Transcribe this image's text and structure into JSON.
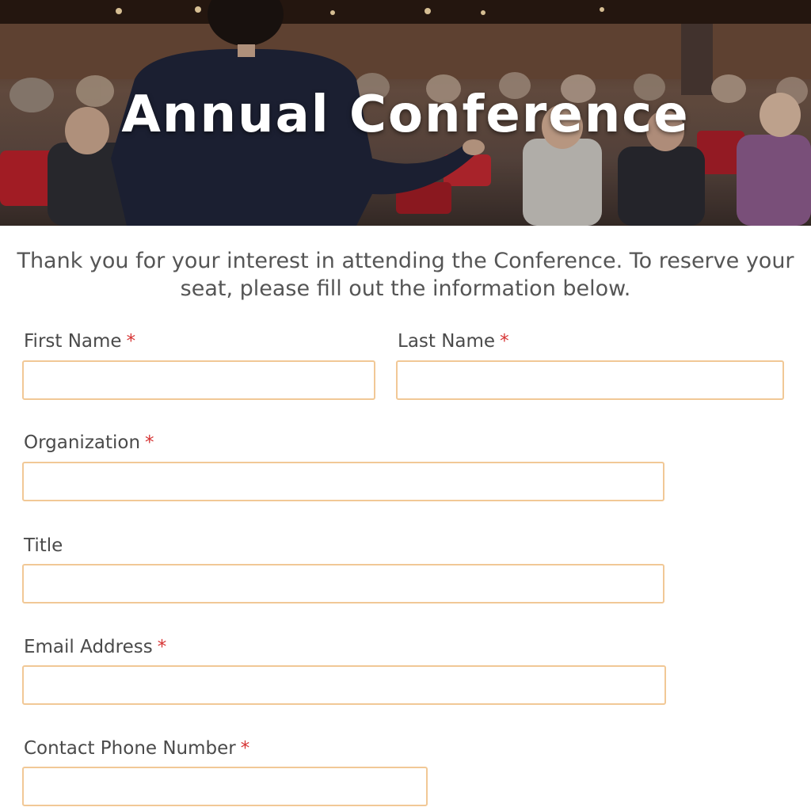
{
  "hero": {
    "title": "Annual Conference"
  },
  "intro": {
    "text": "Thank you for your interest in attending the Conference. To reserve your seat, please fill out the information below."
  },
  "form": {
    "required_marker": "*",
    "first_name": {
      "label": "First Name",
      "value": ""
    },
    "last_name": {
      "label": "Last Name",
      "value": ""
    },
    "organization": {
      "label": "Organization",
      "value": ""
    },
    "title": {
      "label": "Title",
      "value": ""
    },
    "email": {
      "label": "Email Address",
      "value": ""
    },
    "phone": {
      "label": "Contact Phone Number",
      "value": ""
    }
  },
  "colors": {
    "input_border": "#f1c896",
    "required": "#d63333",
    "label": "#4a4a4a"
  }
}
